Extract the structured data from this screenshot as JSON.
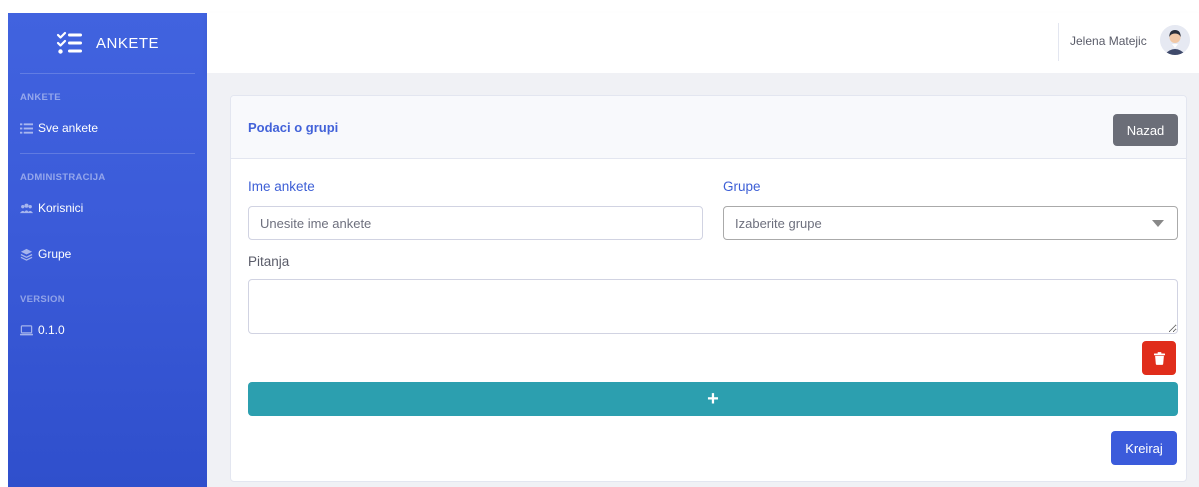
{
  "sidebar": {
    "brand": "ANKETE",
    "sections": [
      {
        "heading": "ANKETE",
        "items": [
          {
            "label": "Sve ankete",
            "icon": "list-icon"
          }
        ]
      },
      {
        "heading": "ADMINISTRACIJA",
        "items": [
          {
            "label": "Korisnici",
            "icon": "users-icon"
          },
          {
            "label": "Grupe",
            "icon": "layers-icon"
          }
        ]
      },
      {
        "heading": "VERSION",
        "items": [
          {
            "label": "0.1.0",
            "icon": "laptop-icon"
          }
        ]
      }
    ]
  },
  "topbar": {
    "user_name": "Jelena Matejic"
  },
  "card": {
    "title": "Podaci o grupi",
    "back_label": "Nazad",
    "name_label": "Ime ankete",
    "name_placeholder": "Unesite ime ankete",
    "groups_label": "Grupe",
    "groups_selected": "Izaberite grupe",
    "questions_label": "Pitanja",
    "add_label": "+",
    "create_label": "Kreiraj"
  },
  "colors": {
    "sidebar_top": "#4163df",
    "sidebar_bottom": "#2f4fcc",
    "primary": "#3b5bdb",
    "info": "#2c9faf",
    "danger": "#e02d1b",
    "secondary": "#6b6e78"
  }
}
